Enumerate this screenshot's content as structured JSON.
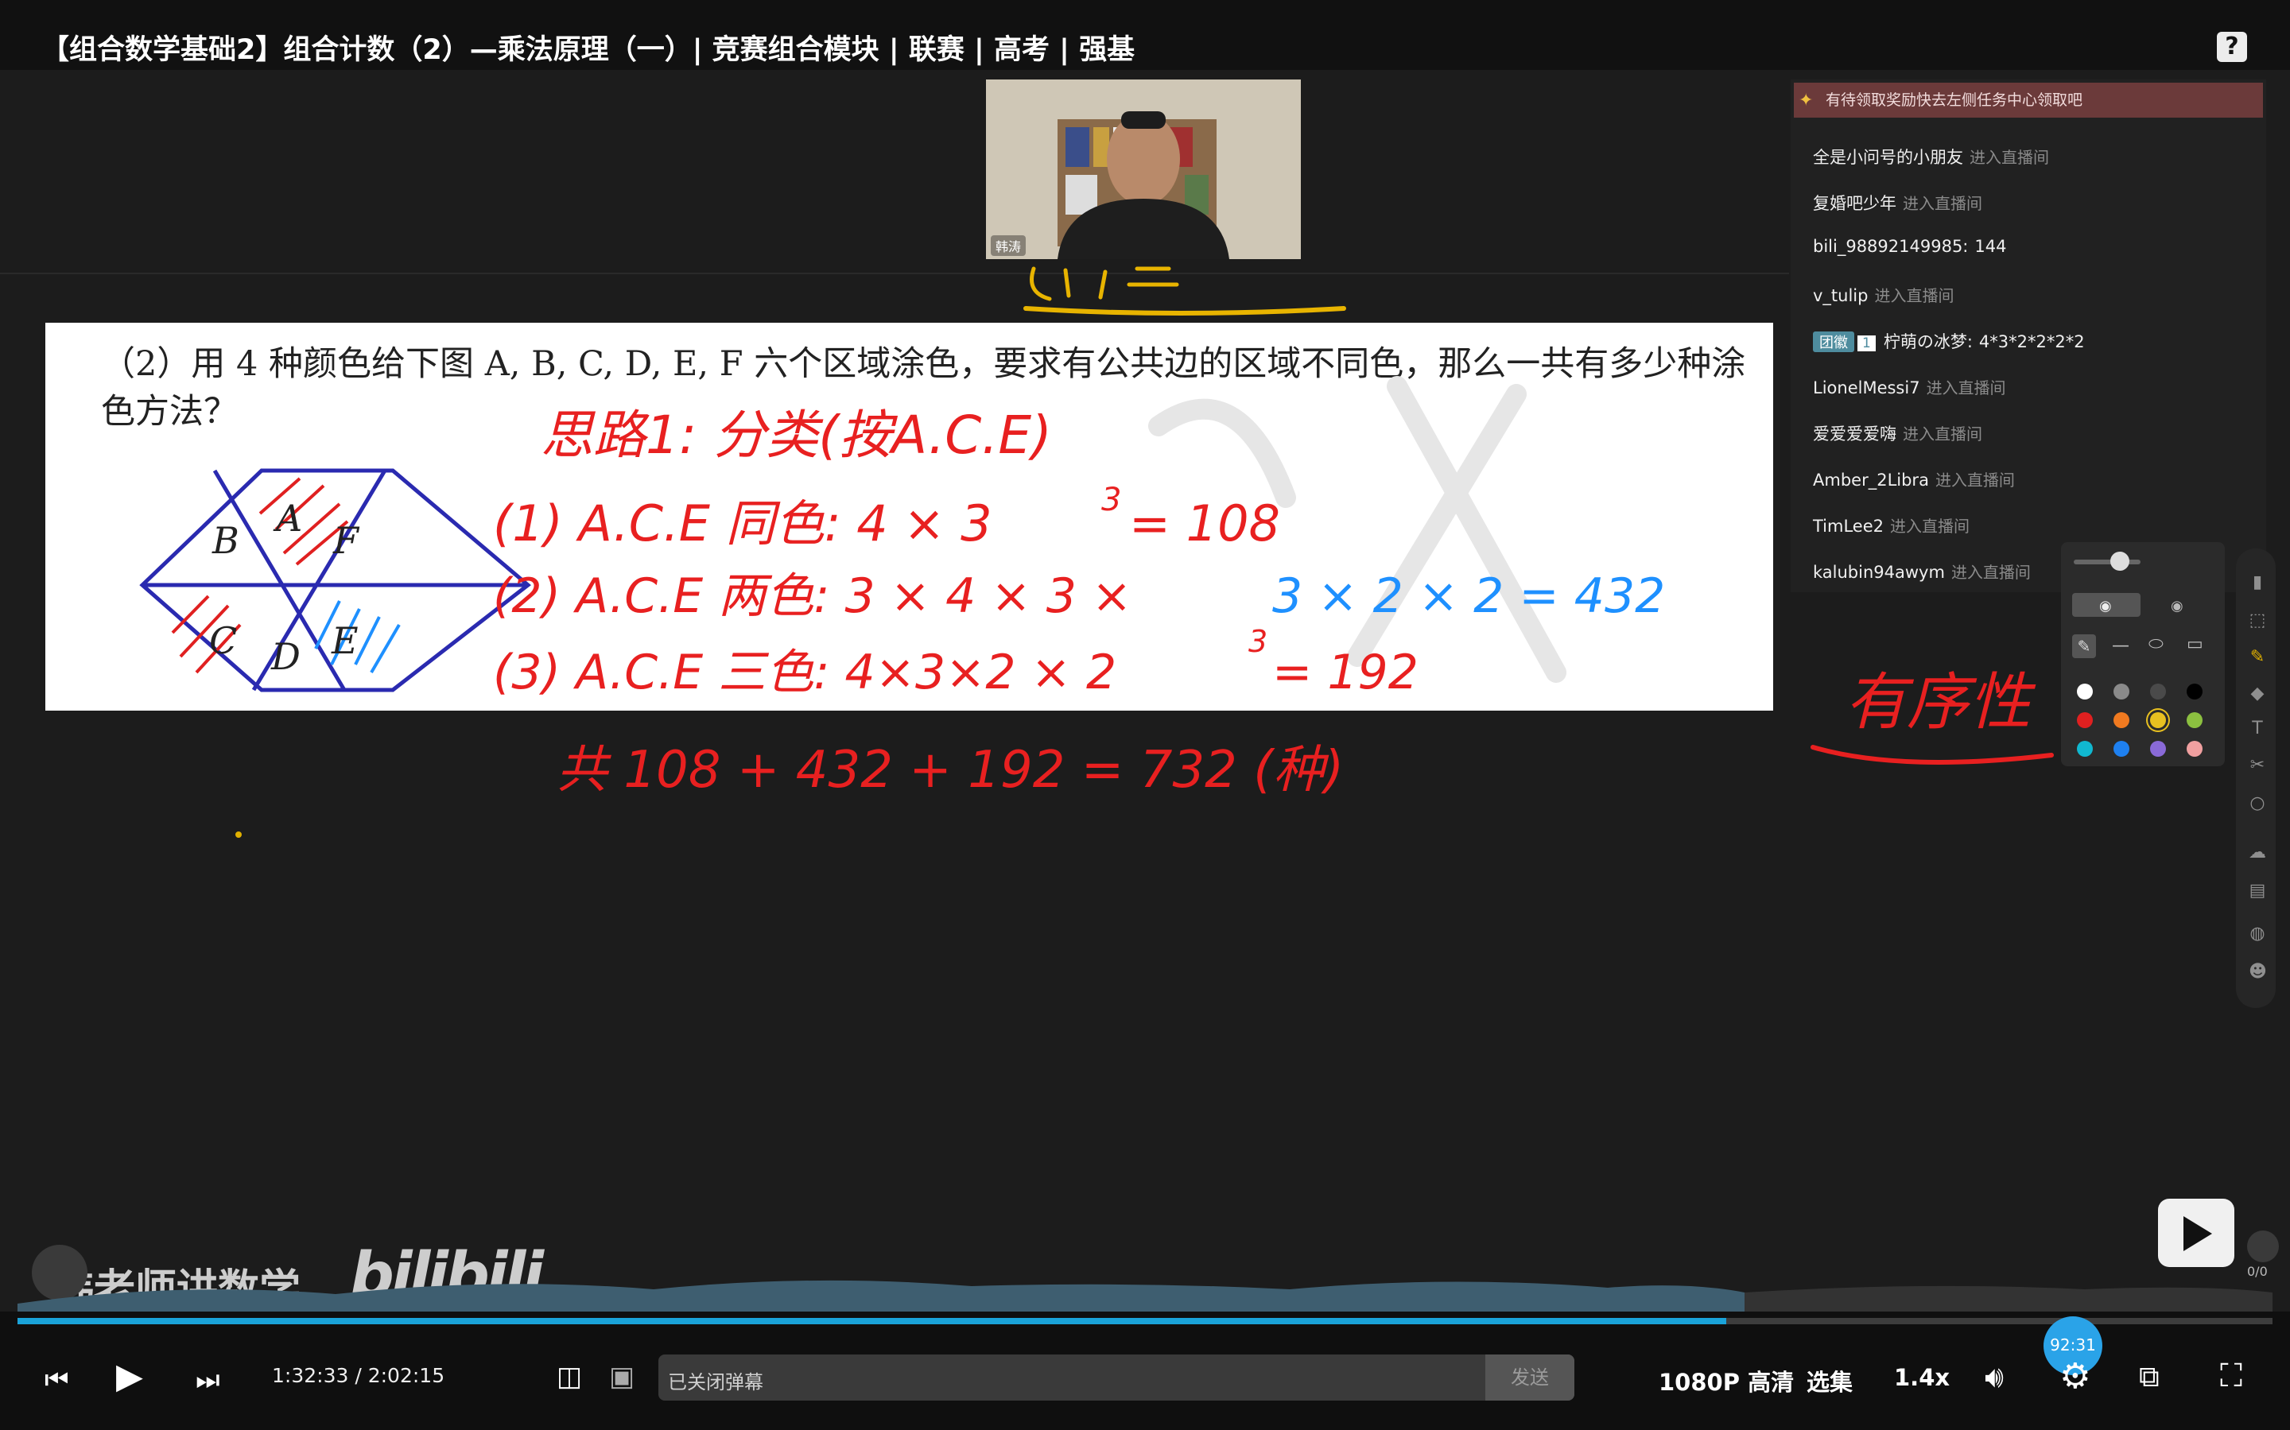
{
  "title": "【组合数学基础2】组合计数（2）—乘法原理（一）| 竞赛组合模块 | 联赛 | 高考 | 强基",
  "icons": {
    "help": "help-icon",
    "prev": "skip-previous-icon",
    "play": "play-icon",
    "next": "skip-next-icon",
    "volume": "volume-icon",
    "settings": "gear-icon",
    "pip": "picture-in-picture-icon",
    "fullscreen": "fullscreen-icon"
  },
  "webcam": {
    "name": "韩涛"
  },
  "problem": {
    "text": "（2）用 4 种颜色给下图 A, B, C, D, E, F 六个区域涂色，要求有公共边的区域不同色，那么一共有多少种涂色方法？",
    "regions": [
      "A",
      "B",
      "C",
      "D",
      "E",
      "F"
    ]
  },
  "handwriting": {
    "line0": "思路1: 分类(按A.C.E)",
    "line1": "(1) A.C.E 同色: 4 × 3",
    "line1_exp": "3",
    "line1_result": "= 108",
    "line2_red": "(2) A.C.E 两色: 3 × 4 × 3 ×",
    "line2_blue": "3 × 2 × 2 = 432",
    "line3": "(3) A.C.E 三色: 4×3×2 × 2",
    "line3_exp": "3",
    "line3_result": "= 192",
    "total": "共 108 + 432 + 192 = 732 (种)",
    "side_note": "有序性",
    "top_fragment": "(思路 1.2)"
  },
  "chat": {
    "notice": "有待领取奖励快去左侧任务中心领取吧",
    "messages": [
      {
        "user": "全是小问号的小朋友",
        "text": "进入直播间",
        "system": true
      },
      {
        "user": "复婚吧少年",
        "text": "进入直播间",
        "system": true
      },
      {
        "user": "bili_98892149985:",
        "text": "144",
        "system": false
      },
      {
        "user": "v_tulip",
        "text": "进入直播间",
        "system": true
      },
      {
        "user": "柠萌の冰梦:",
        "text": "4*3*2*2*2*2",
        "system": false,
        "badge": "团徽",
        "level": "1"
      },
      {
        "user": "LionelMessi7",
        "text": "进入直播间",
        "system": true
      },
      {
        "user": "爱爱爱爱嗨",
        "text": "进入直播间",
        "system": true
      },
      {
        "user": "Amber_2Libra",
        "text": "进入直播间",
        "system": true
      },
      {
        "user": "TimLee2",
        "text": "进入直播间",
        "system": true
      },
      {
        "user": "kalubin94awym",
        "text": "进入直播间",
        "system": true
      }
    ]
  },
  "pen_colors": [
    "#ffffff",
    "#8a8a8a",
    "#4a4a4a",
    "#000000",
    "#e02020",
    "#f07a20",
    "#e8c020",
    "#8cc040",
    "#10b8d0",
    "#1e80f0",
    "#8a6ad8",
    "#f0a0a0"
  ],
  "watermark": {
    "channel": "韩老师讲数学",
    "logo": "bilibili"
  },
  "player": {
    "current_time": "1:32:33",
    "separator": "/",
    "duration": "2:02:15",
    "progress": 0.7578,
    "preview_label": "92:31",
    "danmaku_placeholder": "已关闭弹幕",
    "send_label": "发送",
    "quality": "1080P 高清",
    "episodes": "选集",
    "speed": "1.4x",
    "counter": "0/0"
  }
}
